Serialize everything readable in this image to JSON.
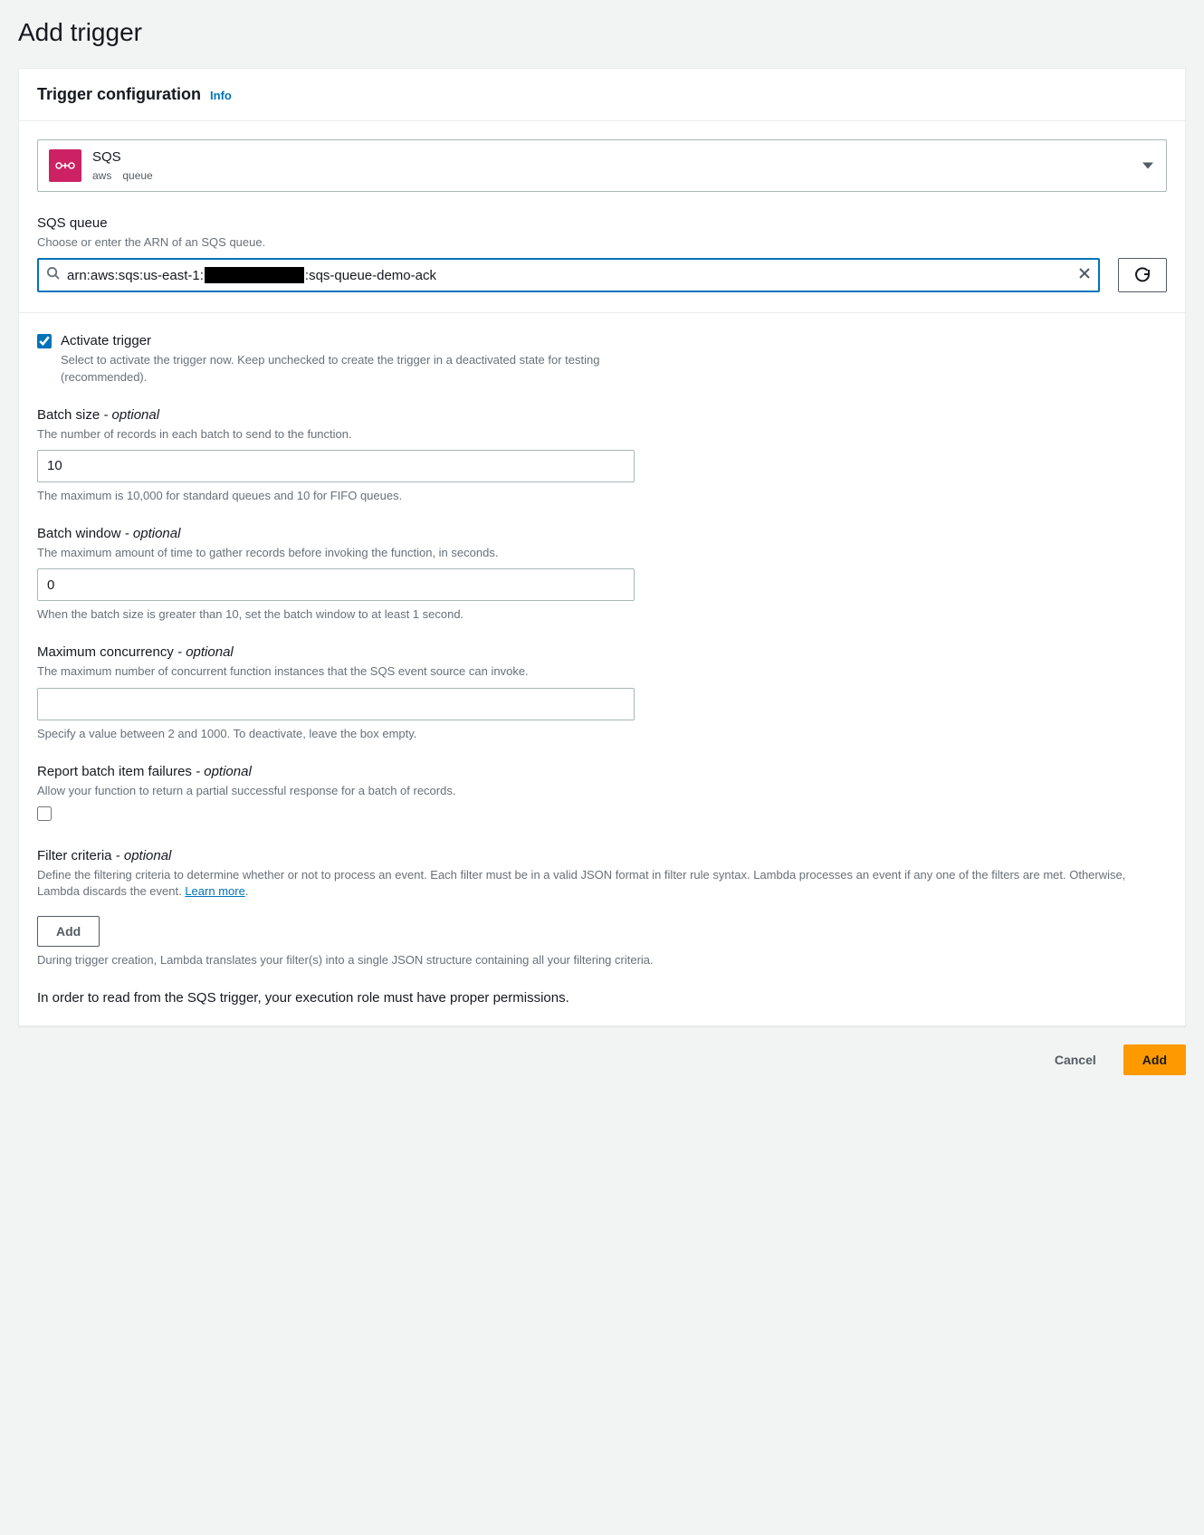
{
  "page_title": "Add trigger",
  "panel": {
    "title": "Trigger configuration",
    "info_label": "Info"
  },
  "source": {
    "icon_name": "sqs-icon",
    "name": "SQS",
    "tag1": "aws",
    "tag2": "queue"
  },
  "sqs_queue": {
    "label": "SQS queue",
    "hint": "Choose or enter the ARN of an SQS queue.",
    "arn_prefix": "arn:aws:sqs:us-east-1:",
    "arn_suffix": ":sqs-queue-demo-ack"
  },
  "activate": {
    "label": "Activate trigger",
    "hint": "Select to activate the trigger now. Keep unchecked to create the trigger in a deactivated state for testing (recommended).",
    "checked": true
  },
  "batch_size": {
    "label_main": "Batch size",
    "label_optional": " - optional",
    "hint": "The number of records in each batch to send to the function.",
    "value": "10",
    "hint_below": "The maximum is 10,000 for standard queues and 10 for FIFO queues."
  },
  "batch_window": {
    "label_main": "Batch window",
    "label_optional": " - optional",
    "hint": "The maximum amount of time to gather records before invoking the function, in seconds.",
    "value": "0",
    "hint_below": "When the batch size is greater than 10, set the batch window to at least 1 second."
  },
  "max_concurrency": {
    "label_main": "Maximum concurrency",
    "label_optional": " - optional",
    "hint": "The maximum number of concurrent function instances that the SQS event source can invoke.",
    "value": "",
    "hint_below": "Specify a value between 2 and 1000. To deactivate, leave the box empty."
  },
  "report_failures": {
    "label_main": "Report batch item failures",
    "label_optional": " - optional",
    "hint": "Allow your function to return a partial successful response for a batch of records.",
    "checked": false
  },
  "filter_criteria": {
    "label_main": "Filter criteria",
    "label_optional": " - optional",
    "hint": "Define the filtering criteria to determine whether or not to process an event. Each filter must be in a valid JSON format in filter rule syntax. Lambda processes an event if any one of the filters are met. Otherwise, Lambda discards the event. ",
    "learn_more_label": "Learn more",
    "add_button_label": "Add",
    "hint_below": "During trigger creation, Lambda translates your filter(s) into a single JSON structure containing all your filtering criteria."
  },
  "permissions_note": "In order to read from the SQS trigger, your execution role must have proper permissions.",
  "footer": {
    "cancel": "Cancel",
    "add": "Add"
  },
  "colors": {
    "accent": "#0073bb",
    "primary_action": "#ff9900",
    "sqs_brand": "#cc2264"
  }
}
